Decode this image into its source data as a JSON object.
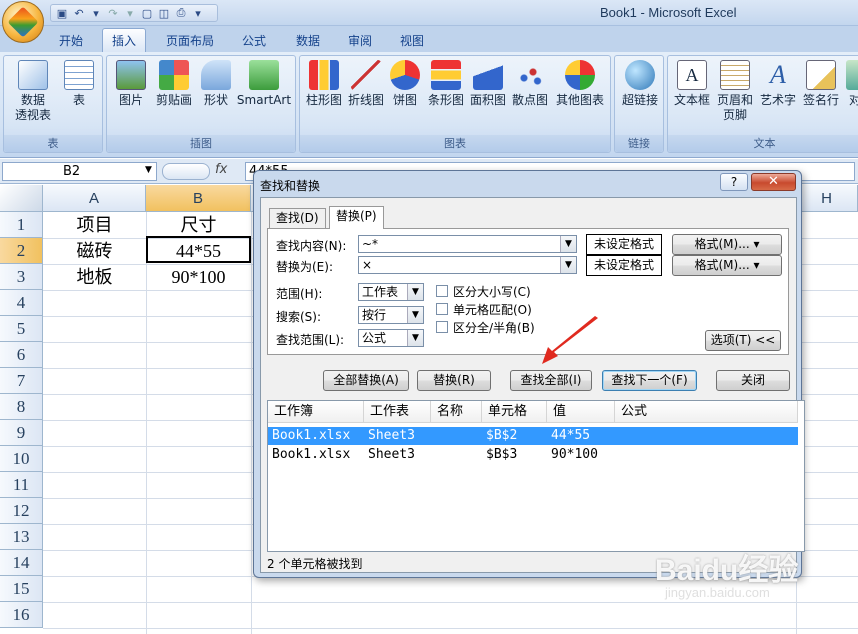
{
  "window": {
    "title": "Book1 - Microsoft Excel"
  },
  "tabs": [
    "开始",
    "插入",
    "页面布局",
    "公式",
    "数据",
    "审阅",
    "视图"
  ],
  "ribbon": {
    "groups": [
      {
        "title": "表",
        "buttons": [
          "数据\n透视表",
          "表"
        ]
      },
      {
        "title": "插图",
        "buttons": [
          "图片",
          "剪贴画",
          "形状",
          "SmartArt"
        ]
      },
      {
        "title": "图表",
        "buttons": [
          "柱形图",
          "折线图",
          "饼图",
          "条形图",
          "面积图",
          "散点图",
          "其他图表"
        ]
      },
      {
        "title": "链接",
        "buttons": [
          "超链接"
        ]
      },
      {
        "title": "文本",
        "buttons": [
          "文本框",
          "页眉和\n页脚",
          "艺术字",
          "签名行",
          "对"
        ]
      }
    ]
  },
  "formula_bar": {
    "name_box": "B2",
    "fx": "fx",
    "value": "44*55"
  },
  "sheet": {
    "columns": [
      "A",
      "B",
      "H"
    ],
    "rows": [
      "1",
      "2",
      "3",
      "4",
      "5",
      "6",
      "7",
      "8",
      "9",
      "10",
      "11",
      "12",
      "13",
      "14",
      "15",
      "16"
    ],
    "cells": {
      "A1": "项目",
      "B1": "尺寸",
      "A2": "磁砖",
      "B2": "44*55",
      "A3": "地板",
      "B3": "90*100"
    }
  },
  "dialog": {
    "title": "查找和替换",
    "help": "?",
    "close": "✕",
    "tabs": [
      "查找(D)",
      "替换(P)"
    ],
    "find_label": "查找内容(N):",
    "find_value": "~*",
    "replace_label": "替换为(E):",
    "replace_value": "×",
    "format_status": "未设定格式",
    "format_button": "格式(M)...",
    "scope_label": "范围(H):",
    "scope_value": "工作表",
    "search_label": "搜索(S):",
    "search_value": "按行",
    "lookin_label": "查找范围(L):",
    "lookin_value": "公式",
    "opt_case": "区分大小写(C)",
    "opt_cell": "单元格匹配(O)",
    "opt_width": "区分全/半角(B)",
    "options_button": "选项(T) <<",
    "btn_replace_all": "全部替换(A)",
    "btn_replace": "替换(R)",
    "btn_find_all": "查找全部(I)",
    "btn_find_next": "查找下一个(F)",
    "btn_close": "关闭",
    "result_headers": [
      "工作簿",
      "工作表",
      "名称",
      "单元格",
      "值",
      "公式"
    ],
    "results": [
      {
        "book": "Book1.xlsx",
        "sheet": "Sheet3",
        "name": "",
        "cell": "$B$2",
        "value": "44*55",
        "formula": ""
      },
      {
        "book": "Book1.xlsx",
        "sheet": "Sheet3",
        "name": "",
        "cell": "$B$3",
        "value": "90*100",
        "formula": ""
      }
    ],
    "status": "2 个单元格被找到"
  },
  "watermark": {
    "main": "Baidu经验",
    "sub": "jingyan.baidu.com"
  }
}
